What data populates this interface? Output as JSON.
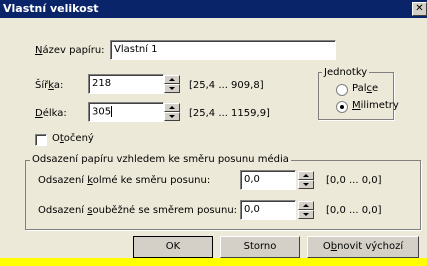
{
  "window": {
    "title": "Vlastní velikost",
    "close_glyph": "✕"
  },
  "paper_name": {
    "label": "Název papíru:",
    "value": "Vlastní 1"
  },
  "width": {
    "label": "Šířka:",
    "value": "218",
    "range": "[25,4 ... 909,8]"
  },
  "length": {
    "label": "Délka:",
    "value": "305",
    "range": "[25,4 ... 1159,9]"
  },
  "units": {
    "legend": "Jednotky",
    "option_inches": "Palce",
    "option_mm": "Milimetry",
    "selected": "Milimetry"
  },
  "rotated": {
    "label": "Otočený",
    "checked": false
  },
  "offset": {
    "legend": "Odsazení papíru vzhledem ke směru posunu média",
    "perpendicular": {
      "label": "Odsazení kolmé ke směru posunu:",
      "value": "0,0",
      "range": "[0,0 ... 0,0]"
    },
    "parallel": {
      "label": "Odsazení souběžné se směrem posunu:",
      "value": "0,0",
      "range": "[0,0 ... 0,0]"
    }
  },
  "buttons": {
    "ok": "OK",
    "cancel": "Storno",
    "restore": "Obnovit výchozí"
  },
  "colors": {
    "titlebar": "#0a246a",
    "dialog": "#ece9d8",
    "outer": "#ffff00"
  }
}
